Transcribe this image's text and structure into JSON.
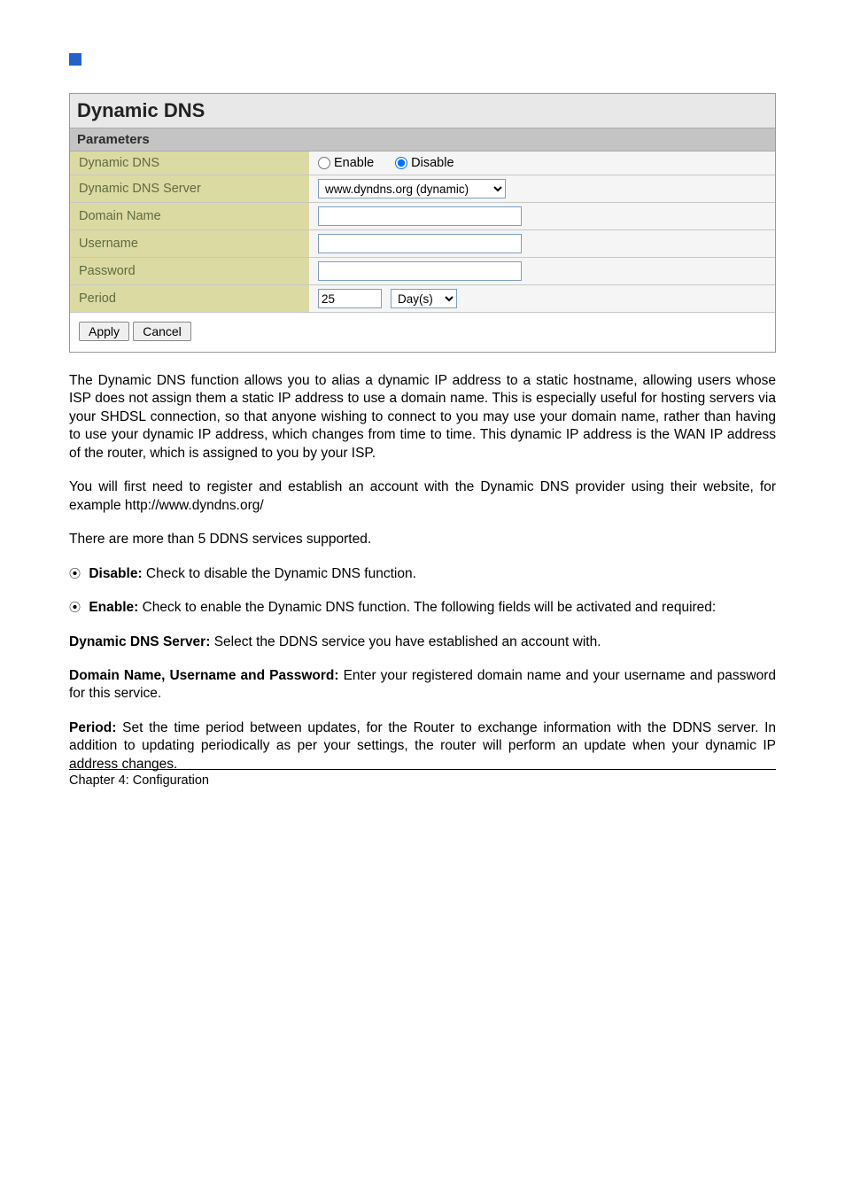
{
  "panel": {
    "title": "Dynamic DNS",
    "section_header": "Parameters",
    "rows": {
      "dynamic_dns_label": "Dynamic DNS",
      "enable_label": "Enable",
      "disable_label": "Disable",
      "server_label": "Dynamic DNS Server",
      "server_value": "www.dyndns.org (dynamic)",
      "domain_label": "Domain Name",
      "domain_value": "",
      "username_label": "Username",
      "username_value": "",
      "password_label": "Password",
      "password_value": "",
      "period_label": "Period",
      "period_value": "25",
      "period_unit": "Day(s)"
    },
    "apply_btn": "Apply",
    "cancel_btn": "Cancel"
  },
  "content": {
    "p1": "The Dynamic DNS function allows you to alias a dynamic IP address to a static hostname, allowing users whose ISP does not assign them a static IP address to use a domain name. This is especially useful for hosting servers via your SHDSL connection, so that anyone wishing to connect to you may use your domain name, rather than having to use your dynamic IP address, which changes from time to time. This dynamic IP address is the WAN IP address of the router, which is assigned to you by your ISP.",
    "p2": "You will first need to register and establish an account with the Dynamic DNS provider using their website, for example http://www.dyndns.org/",
    "p3": "There are more than 5 DDNS services supported.",
    "p4_label": "Disable: ",
    "p4_text": "Check to disable the Dynamic DNS function.",
    "p5_label": "Enable: ",
    "p5_text": "Check to enable the Dynamic DNS function. The following fields will be activated and required:",
    "p6_label": "Dynamic DNS Server: ",
    "p6_text": "Select the DDNS service you have established an account with.",
    "p7_label": "Domain Name, Username and Password: ",
    "p7_text": "Enter your registered domain name and your username and password for this service.",
    "p8_label": "Period: ",
    "p8_text": "Set the time period between updates, for the Router to exchange information with the DDNS server. In addition to updating periodically as per your settings, the router will perform an update when your dynamic IP address changes."
  },
  "footer": "Chapter 4: Configuration"
}
